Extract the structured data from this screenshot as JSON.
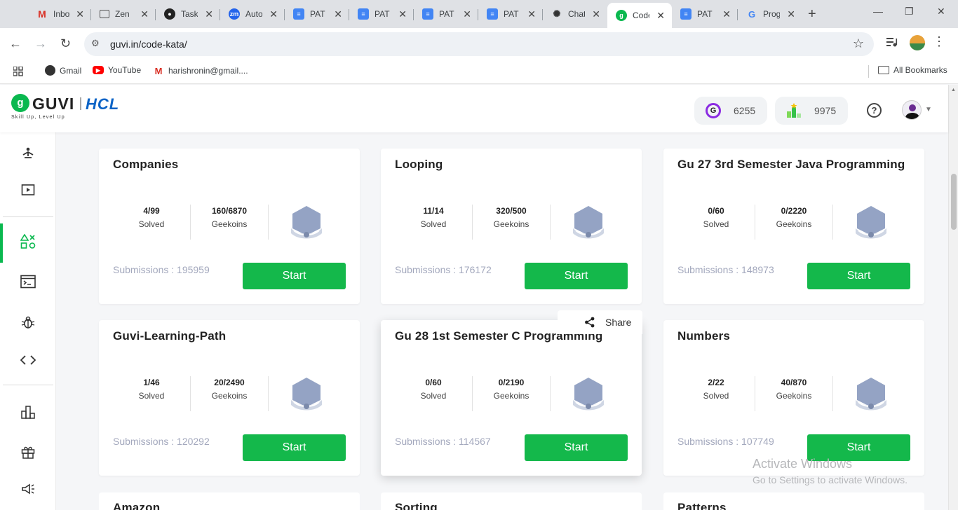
{
  "browser": {
    "tabs": [
      {
        "label": "Inbox",
        "icon": "gmail-icon"
      },
      {
        "label": "Zen",
        "icon": "zen-icon"
      },
      {
        "label": "Task",
        "icon": "github-icon"
      },
      {
        "label": "Auto",
        "icon": "zm-icon",
        "icon_text": "zm"
      },
      {
        "label": "PAT",
        "icon": "docs-icon"
      },
      {
        "label": "PAT",
        "icon": "docs-icon"
      },
      {
        "label": "PAT",
        "icon": "docs-icon"
      },
      {
        "label": "PAT",
        "icon": "docs-icon"
      },
      {
        "label": "Chat",
        "icon": "chatgpt-icon"
      },
      {
        "label": "Code",
        "icon": "guvi-icon",
        "active": true
      },
      {
        "label": "PAT",
        "icon": "docs-icon"
      },
      {
        "label": "Prog",
        "icon": "google-icon"
      }
    ],
    "url": "guvi.in/code-kata/",
    "bookmarks": [
      {
        "label": "Gmail",
        "icon": "chrome-icon"
      },
      {
        "label": "YouTube",
        "icon": "youtube-icon"
      },
      {
        "label": "harishronin@gmail....",
        "icon": "gmail-icon"
      }
    ],
    "all_bookmarks": "All Bookmarks"
  },
  "header": {
    "logo_letter": "g",
    "brand": "GUVI",
    "partner": "HCL",
    "tagline": "Skill Up, Level Up",
    "geekoins": "6255",
    "score": "9975",
    "help": "?"
  },
  "sidebar": {
    "items": [
      {
        "name": "yoga-icon"
      },
      {
        "name": "video-icon"
      },
      {
        "name": "code-kata-icon",
        "active": true
      },
      {
        "name": "terminal-icon"
      },
      {
        "name": "bug-icon"
      },
      {
        "name": "code-brackets-icon"
      },
      {
        "name": "leaderboard-icon"
      },
      {
        "name": "gift-icon"
      },
      {
        "name": "announcement-icon"
      }
    ]
  },
  "cards": [
    {
      "title": "Companies",
      "solved": "4/99",
      "solved_label": "Solved",
      "geekoins": "160/6870",
      "geekoins_label": "Geekoins",
      "submissions": "Submissions : 195959",
      "button": "Start"
    },
    {
      "title": "Looping",
      "solved": "11/14",
      "solved_label": "Solved",
      "geekoins": "320/500",
      "geekoins_label": "Geekoins",
      "submissions": "Submissions : 176172",
      "button": "Start"
    },
    {
      "title": "Gu 27 3rd Semester Java Programming",
      "solved": "0/60",
      "solved_label": "Solved",
      "geekoins": "0/2220",
      "geekoins_label": "Geekoins",
      "submissions": "Submissions : 148973",
      "button": "Start"
    },
    {
      "title": "Guvi-Learning-Path",
      "solved": "1/46",
      "solved_label": "Solved",
      "geekoins": "20/2490",
      "geekoins_label": "Geekoins",
      "submissions": "Submissions : 120292",
      "button": "Start"
    },
    {
      "title": "Gu 28 1st Semester C Programming",
      "solved": "0/60",
      "solved_label": "Solved",
      "geekoins": "0/2190",
      "geekoins_label": "Geekoins",
      "submissions": "Submissions : 114567",
      "button": "Start",
      "hovered": true
    },
    {
      "title": "Numbers",
      "solved": "2/22",
      "solved_label": "Solved",
      "geekoins": "40/870",
      "geekoins_label": "Geekoins",
      "submissions": "Submissions : 107749",
      "button": "Start"
    }
  ],
  "peek_cards": [
    "Amazon",
    "Sorting",
    "Patterns"
  ],
  "share_label": "Share",
  "watermark": {
    "line1": "Activate Windows",
    "line2": "Go to Settings to activate Windows."
  },
  "colors": {
    "accent": "#14b84b",
    "brand_green": "#0ab84f",
    "hcl_blue": "#0b63c6",
    "badge": "#94a3c4"
  }
}
